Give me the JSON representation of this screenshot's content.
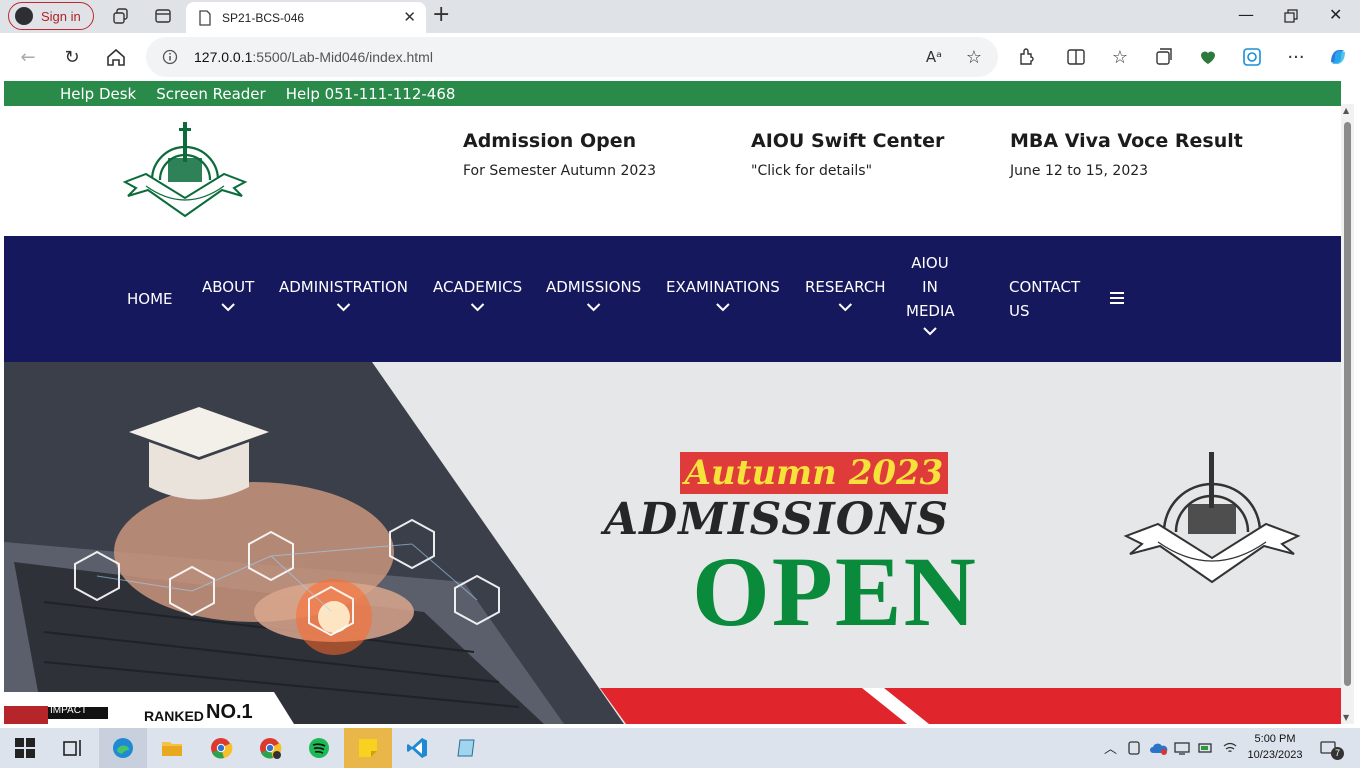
{
  "browser": {
    "signin_label": "Sign in",
    "tab_title": "SP21-BCS-046",
    "address_host": "127.0.0.1",
    "address_rest": ":5500/Lab-Mid046/index.html",
    "read_aloud_glyph": "Aᵃ"
  },
  "site": {
    "topbar": [
      "Help Desk",
      "Screen Reader",
      "Help 051-111-112-468"
    ],
    "header": [
      {
        "title": "Admission Open",
        "subtitle": "For Semester Autumn 2023"
      },
      {
        "title": "AIOU Swift Center",
        "subtitle": "\"Click for details\""
      },
      {
        "title": "MBA Viva Voce Result",
        "subtitle": "June 12 to 15, 2023"
      }
    ],
    "nav": {
      "home": "HOME",
      "about": "ABOUT",
      "administration": "ADMINISTRATION",
      "academics": "ACADEMICS",
      "admissions": "ADMISSIONS",
      "examinations": "EXAMINATIONS",
      "research": "RESEARCH",
      "media_l1": "AIOU",
      "media_l2": "IN",
      "media_l3": "MEDIA",
      "contact_l1": "CONTACT",
      "contact_l2": "US"
    },
    "banner": {
      "autumn": "Autumn 2023",
      "admissions": "ADMISSIONS",
      "open": "OPEN",
      "ranked": "RANKED",
      "no1": "NO.1",
      "impact": "IMPACT"
    },
    "colors": {
      "topbar": "#2a8a4a",
      "nav": "#16185d",
      "open": "#0a8a3b",
      "autumn_bg": "#e03b3b"
    }
  },
  "taskbar": {
    "time": "5:00 PM",
    "date": "10/23/2023",
    "notifications": "7"
  }
}
